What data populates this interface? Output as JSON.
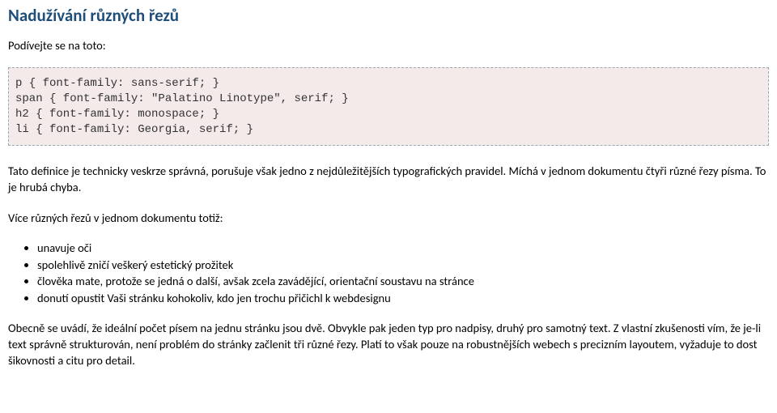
{
  "title": "Nadužívání různých řezů",
  "intro": "Podívejte se na toto:",
  "code": "p { font-family: sans-serif; }\nspan { font-family: \"Palatino Linotype\", serif; }\nh2 { font-family: monospace; }\nli { font-family: Georgia, serif; }",
  "para1": "Tato definice je technicky veskrze správná, porušuje však jedno z nejdůležitějších typografických pravidel. Míchá v jednom dokumentu čtyři různé řezy písma. To je hrubá chyba.",
  "para2": "Více různých řezů v jednom dokumentu totiž:",
  "bullets": [
    "unavuje oči",
    "spolehlivě zničí veškerý estetický prožitek",
    "člověka mate, protože se jedná o další, avšak zcela zavádějící, orientační soustavu na stránce",
    "donutí opustit Vaši stránku kohokoliv, kdo jen trochu přičichl k webdesignu"
  ],
  "footer": "Obecně se uvádí, že ideální počet písem na jednu stránku jsou dvě. Obvykle pak jeden typ pro nadpisy, druhý pro samotný text. Z vlastní zkušenosti vím, že je-li text správně strukturován, není problém do stránky začlenit tři různé řezy. Platí to však pouze na robustnějších webech s precizním layoutem, vyžaduje to dost šikovnosti a citu pro detail."
}
